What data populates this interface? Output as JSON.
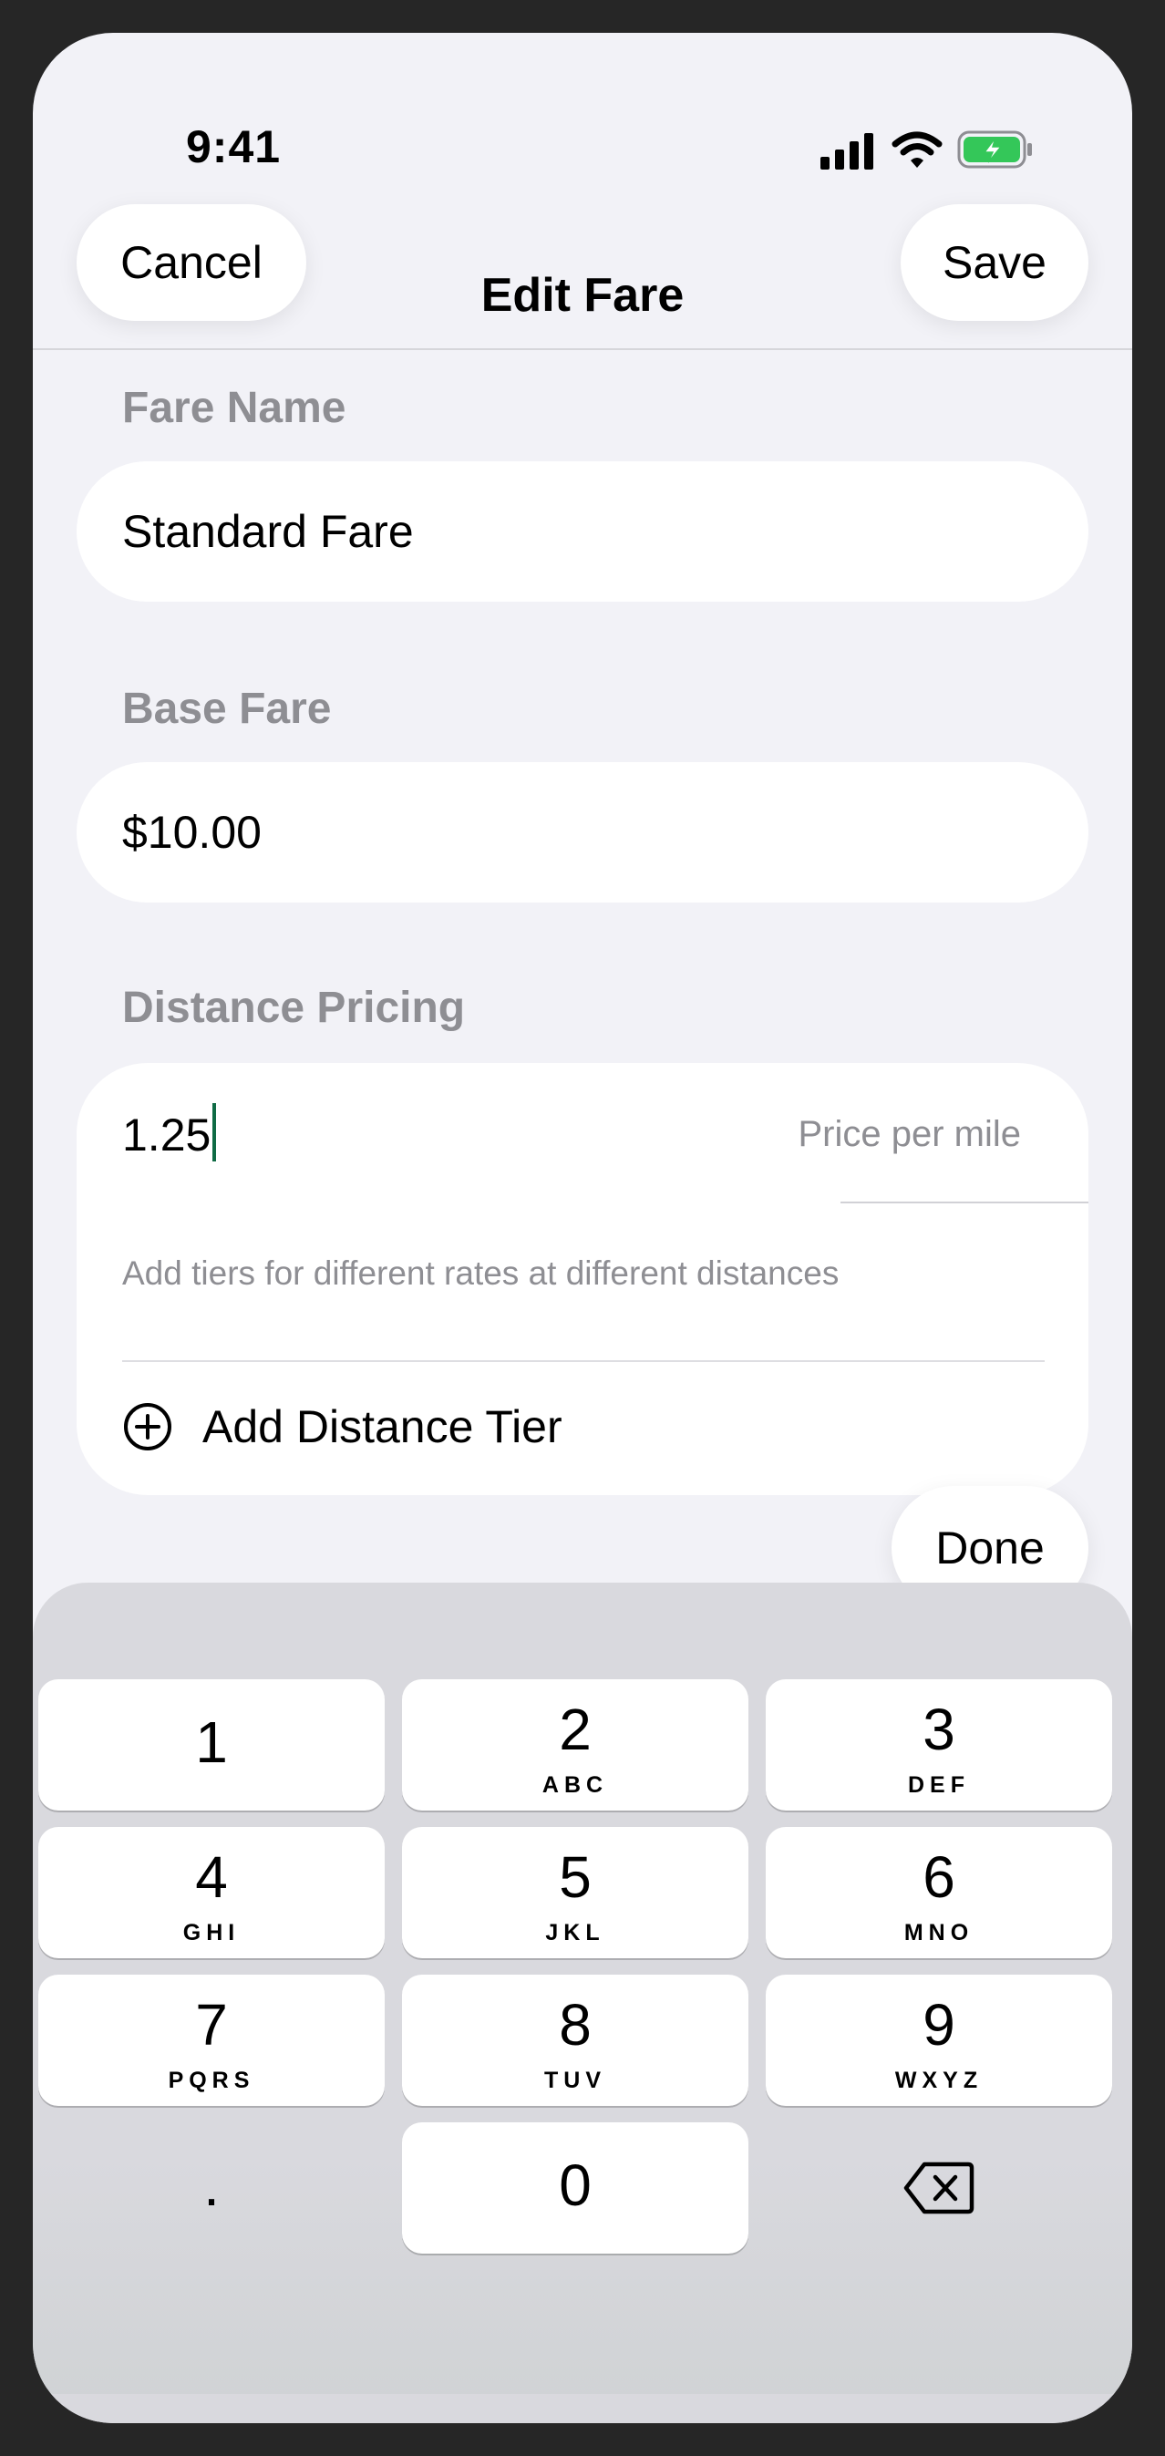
{
  "status_bar": {
    "time": "9:41"
  },
  "nav": {
    "cancel_label": "Cancel",
    "title": "Edit Fare",
    "save_label": "Save"
  },
  "fare_name": {
    "label": "Fare Name",
    "value": "Standard Fare"
  },
  "base_fare": {
    "label": "Base Fare",
    "value": "$10.00"
  },
  "distance_pricing": {
    "label": "Distance Pricing",
    "price_value": "1.25",
    "price_placeholder": "Price per mile",
    "hint": "Add tiers for different rates at different distances",
    "add_tier_label": "Add Distance Tier"
  },
  "keyboard": {
    "done_label": "Done",
    "keys": [
      {
        "num": "1",
        "letters": ""
      },
      {
        "num": "2",
        "letters": "ABC"
      },
      {
        "num": "3",
        "letters": "DEF"
      },
      {
        "num": "4",
        "letters": "GHI"
      },
      {
        "num": "5",
        "letters": "JKL"
      },
      {
        "num": "6",
        "letters": "MNO"
      },
      {
        "num": "7",
        "letters": "PQRS"
      },
      {
        "num": "8",
        "letters": "TUV"
      },
      {
        "num": "9",
        "letters": "WXYZ"
      },
      {
        "num": ".",
        "letters": ""
      },
      {
        "num": "0",
        "letters": ""
      },
      {
        "num": "",
        "letters": "",
        "icon": "delete-backspace-icon"
      }
    ]
  },
  "colors": {
    "caret": "#0f6b45",
    "battery": "#34c759",
    "label_gray": "#8e8e93"
  }
}
